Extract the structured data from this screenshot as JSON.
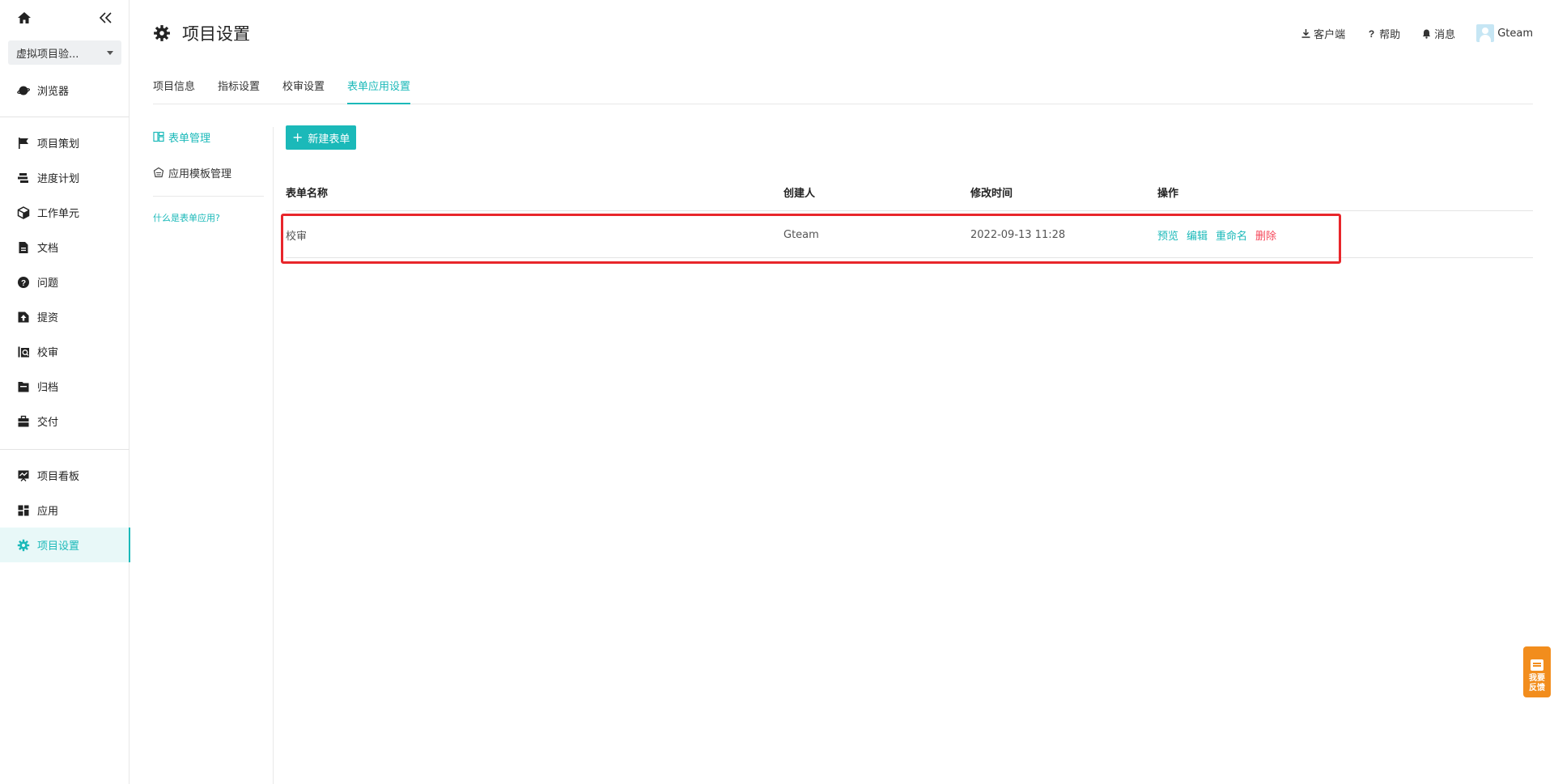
{
  "sidebar": {
    "project_select": "虚拟项目验...",
    "browser": "浏览器",
    "group1": [
      {
        "label": "项目策划",
        "icon": "flag-icon"
      },
      {
        "label": "进度计划",
        "icon": "gantt-icon"
      },
      {
        "label": "工作单元",
        "icon": "cube-icon"
      },
      {
        "label": "文档",
        "icon": "document-icon"
      },
      {
        "label": "问题",
        "icon": "question-icon"
      },
      {
        "label": "提资",
        "icon": "upload-icon"
      },
      {
        "label": "校审",
        "icon": "review-icon"
      },
      {
        "label": "归档",
        "icon": "archive-icon"
      },
      {
        "label": "交付",
        "icon": "briefcase-icon"
      }
    ],
    "group2": [
      {
        "label": "项目看板",
        "icon": "dashboard-icon"
      },
      {
        "label": "应用",
        "icon": "apps-icon"
      },
      {
        "label": "项目设置",
        "icon": "gear-icon",
        "active": true
      }
    ]
  },
  "header": {
    "title": "项目设置",
    "client": "客户端",
    "help": "帮助",
    "messages": "消息",
    "user": "Gteam"
  },
  "tabs": [
    "项目信息",
    "指标设置",
    "校审设置",
    "表单应用设置"
  ],
  "active_tab": 3,
  "subnav": {
    "form_manage": "表单管理",
    "template_manage": "应用模板管理",
    "help_link": "什么是表单应用?"
  },
  "new_button": "新建表单",
  "table": {
    "headers": [
      "表单名称",
      "创建人",
      "修改时间",
      "操作"
    ],
    "rows": [
      {
        "name": "校审",
        "creator": "Gteam",
        "modified": "2022-09-13 11:28"
      }
    ],
    "actions": [
      "预览",
      "编辑",
      "重命名",
      "删除"
    ]
  },
  "feedback": {
    "line1": "我要",
    "line2": "反馈"
  },
  "colors": {
    "accent": "#1bb9b9",
    "danger": "#f5475a",
    "highlight": "#e8262b",
    "feedback": "#f28d1d"
  }
}
